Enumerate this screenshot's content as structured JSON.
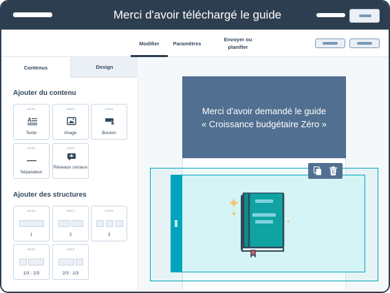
{
  "header": {
    "title": "Merci d'avoir téléchargé le guide"
  },
  "tabs": [
    {
      "label": "Modifier"
    },
    {
      "label": "Paramètres"
    },
    {
      "label": "Envoyer ou planifier"
    }
  ],
  "sidebar": {
    "tabs": [
      {
        "label": "Contenus"
      },
      {
        "label": "Design"
      }
    ],
    "add_content_title": "Ajouter du contenu",
    "content_items": [
      {
        "label": "Texte",
        "icon": "text-icon"
      },
      {
        "label": "Image",
        "icon": "image-icon"
      },
      {
        "label": "Bouton",
        "icon": "button-icon"
      },
      {
        "label": "Séparateur",
        "icon": "divider-icon"
      },
      {
        "label": "Réseaux sociaux",
        "icon": "social-icon"
      }
    ],
    "add_structures_title": "Ajouter des structures",
    "structures": [
      {
        "label": "1"
      },
      {
        "label": "2"
      },
      {
        "label": "3"
      },
      {
        "label": "1/3 : 2/3"
      },
      {
        "label": "2/3 : 1/3"
      }
    ]
  },
  "email": {
    "heading_line1": "Merci d'avoir demandé le guide",
    "heading_line2": "« Croissance budgétaire Zéro »"
  },
  "colors": {
    "header_bg": "#2d3e50",
    "email_header_bg": "#516f90",
    "accent_teal": "#00a4bd",
    "module_bg": "#d4f4f5",
    "book_green": "#0fa3a1",
    "sparkle": "#f5c26b"
  }
}
